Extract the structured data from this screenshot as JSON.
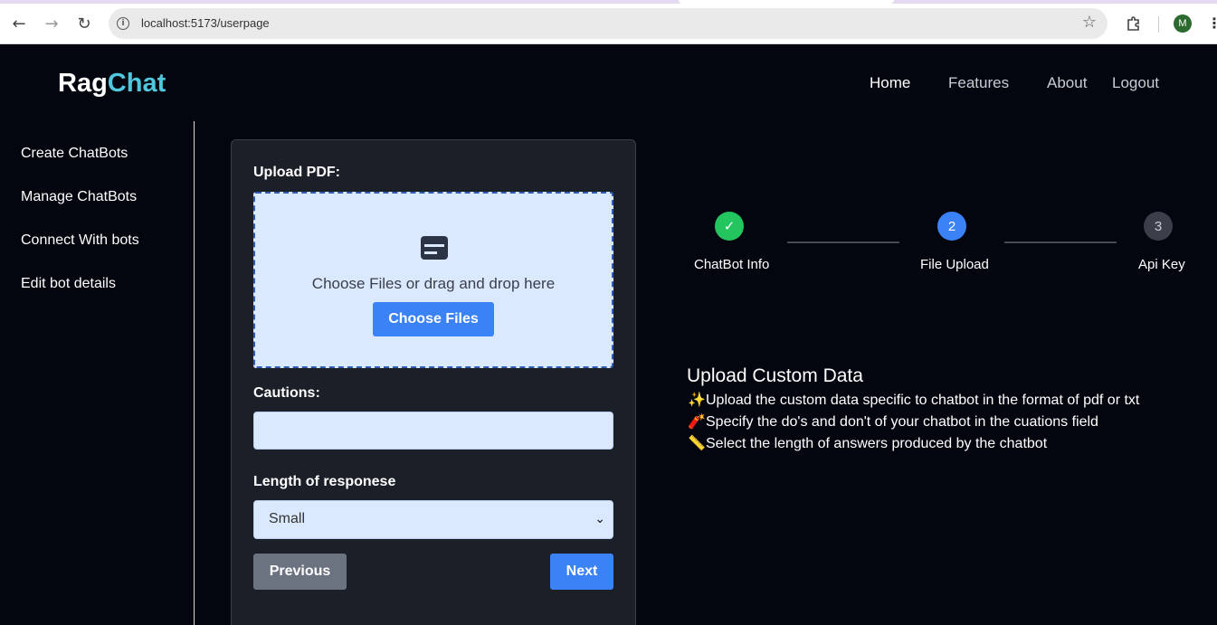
{
  "browser": {
    "url": "localhost:5173/userpage",
    "profile_initial": "M"
  },
  "app": {
    "logo_part1": "Rag",
    "logo_part2": "Chat",
    "accent_color": "#4fc7dc",
    "nav": [
      {
        "label": "Home"
      },
      {
        "label": "Features"
      },
      {
        "label": "About"
      },
      {
        "label": "Logout"
      }
    ]
  },
  "sidebar": {
    "items": [
      {
        "label": "Create ChatBots"
      },
      {
        "label": "Manage ChatBots"
      },
      {
        "label": "Connect With bots"
      },
      {
        "label": "Edit bot details"
      }
    ]
  },
  "form": {
    "upload_label": "Upload PDF:",
    "dropzone_text": "Choose Files or drag and drop here",
    "choose_button": "Choose Files",
    "cautions_label": "Cautions:",
    "cautions_value": "",
    "length_label": "Length of responese",
    "length_selected": "Small",
    "previous_button": "Previous",
    "next_button": "Next"
  },
  "stepper": {
    "steps": [
      {
        "label": "ChatBot Info",
        "number": "✓",
        "status": "done",
        "color": "#22c55e"
      },
      {
        "label": "File Upload",
        "number": "2",
        "status": "active",
        "color": "#3b82f6"
      },
      {
        "label": "Api Key",
        "number": "3",
        "status": "pending",
        "color": "#3a3f4a"
      }
    ]
  },
  "info": {
    "title": "Upload Custom Data",
    "lines": [
      {
        "emoji": "✨",
        "text": "Upload the custom data specific to chatbot in the format of pdf or txt"
      },
      {
        "emoji": "🧨",
        "text": "Specify the do's and don't of your chatbot in the cuations field"
      },
      {
        "emoji": "📏",
        "text": "Select the length of answers produced by the chatbot"
      }
    ]
  }
}
